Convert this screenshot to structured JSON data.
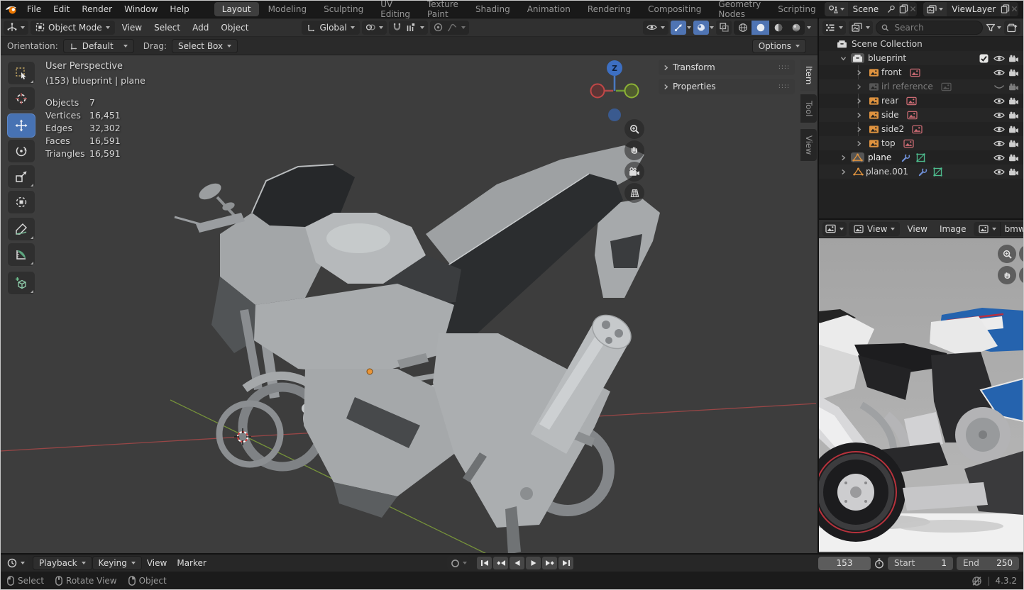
{
  "topbar": {
    "menus": [
      {
        "label": "File"
      },
      {
        "label": "Edit"
      },
      {
        "label": "Render"
      },
      {
        "label": "Window"
      },
      {
        "label": "Help"
      }
    ],
    "tabs": [
      {
        "label": "Layout"
      },
      {
        "label": "Modeling"
      },
      {
        "label": "Sculpting"
      },
      {
        "label": "UV Editing"
      },
      {
        "label": "Texture Paint"
      },
      {
        "label": "Shading"
      },
      {
        "label": "Animation"
      },
      {
        "label": "Rendering"
      },
      {
        "label": "Compositing"
      },
      {
        "label": "Geometry Nodes"
      },
      {
        "label": "Scripting"
      }
    ],
    "active_tab": "Layout",
    "scene_selector": {
      "value": "Scene"
    },
    "viewlayer_selector": {
      "value": "ViewLayer"
    }
  },
  "viewport": {
    "header": {
      "mode": "Object Mode",
      "menus": [
        {
          "label": "View"
        },
        {
          "label": "Select"
        },
        {
          "label": "Add"
        },
        {
          "label": "Object"
        }
      ],
      "orientation": "Global"
    },
    "tool_settings": {
      "orientation_label": "Orientation:",
      "orientation_value": "Default",
      "drag_label": "Drag:",
      "drag_value": "Select Box",
      "options_label": "Options"
    },
    "overlay": {
      "view_name": "User Perspective",
      "context": "(153) blueprint | plane",
      "stats": [
        {
          "label": "Objects",
          "value": "7"
        },
        {
          "label": "Vertices",
          "value": "16,451"
        },
        {
          "label": "Edges",
          "value": "32,302"
        },
        {
          "label": "Faces",
          "value": "16,591"
        },
        {
          "label": "Triangles",
          "value": "16,591"
        }
      ]
    },
    "gizmo": {
      "axis_z_label": "Z"
    },
    "sidebar": {
      "panels": [
        {
          "label": "Transform"
        },
        {
          "label": "Properties"
        }
      ],
      "tabs": [
        {
          "label": "Item"
        },
        {
          "label": "Tool"
        },
        {
          "label": "View"
        }
      ],
      "active_tab": "Item"
    }
  },
  "outliner": {
    "search_placeholder": "Search",
    "root_label": "Scene Collection",
    "items": [
      {
        "label": "blueprint"
      },
      {
        "label": "front"
      },
      {
        "label": "irl reference"
      },
      {
        "label": "rear"
      },
      {
        "label": "side"
      },
      {
        "label": "side2"
      },
      {
        "label": "top"
      },
      {
        "label": "plane"
      },
      {
        "label": "plane.001"
      }
    ]
  },
  "image_editor": {
    "mode": "View",
    "menus": [
      {
        "label": "View"
      },
      {
        "label": "Image"
      }
    ],
    "image_name": "bmw"
  },
  "timeline": {
    "playback_label": "Playback",
    "keying_label": "Keying",
    "menus": [
      {
        "label": "View"
      },
      {
        "label": "Marker"
      }
    ],
    "current_frame": "153",
    "start_label": "Start",
    "start_value": "1",
    "end_label": "End",
    "end_value": "250"
  },
  "statusbar": {
    "hints": [
      {
        "label": "Select"
      },
      {
        "label": "Rotate View"
      },
      {
        "label": "Object"
      }
    ],
    "version": "4.3.2"
  },
  "colors": {
    "accent_blue": "#4772b3",
    "icon_orange": "#df933f",
    "icon_pink": "#c96a72",
    "icon_wrench_blue": "#6f8fd6",
    "icon_green": "#4ebd8e",
    "axis_x_red": "#a84848",
    "axis_y_green": "#7d9c3a",
    "axis_z_blue": "#3d6fc2"
  }
}
